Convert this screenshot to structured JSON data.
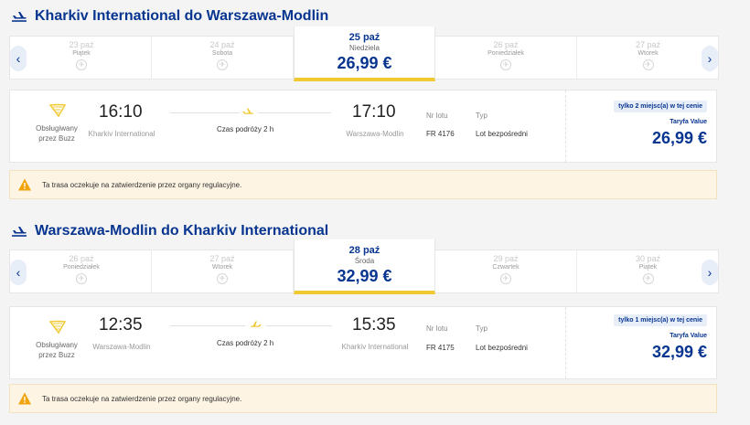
{
  "outbound": {
    "title": "Kharkiv International do Warszawa-Modlin",
    "days": [
      {
        "date": "23 paź",
        "name": "Piątek"
      },
      {
        "date": "24 paź",
        "name": "Sobota"
      },
      {
        "date": "26 paź",
        "name": "Poniedziałek"
      },
      {
        "date": "27 paź",
        "name": "Wtorek"
      }
    ],
    "selected": {
      "date": "25 paź",
      "name": "Niedziela",
      "price": "26,99 €"
    },
    "flight": {
      "operated_by": "Obsługiwany przez Buzz",
      "dep_time": "16:10",
      "dep_city": "Kharkiv International",
      "duration": "Czas podróży 2 h",
      "arr_time": "17:10",
      "arr_city": "Warszawa-Modlin",
      "flight_no_label": "Nr lotu",
      "flight_no": "FR 4176",
      "type_label": "Typ",
      "type": "Lot bezpośredni",
      "seats": "tylko 2 miejsc(a) w tej cenie",
      "fare_name": "Taryfa Value",
      "fare_price": "26,99 €"
    },
    "notice": "Ta trasa oczekuje na zatwierdzenie przez organy regulacyjne."
  },
  "inbound": {
    "title": "Warszawa-Modlin do Kharkiv International",
    "days": [
      {
        "date": "26 paź",
        "name": "Poniedziałek"
      },
      {
        "date": "27 paź",
        "name": "Wtorek"
      },
      {
        "date": "29 paź",
        "name": "Czwartek"
      },
      {
        "date": "30 paź",
        "name": "Piątek"
      }
    ],
    "selected": {
      "date": "28 paź",
      "name": "Środa",
      "price": "32,99 €"
    },
    "flight": {
      "operated_by": "Obsługiwany przez Buzz",
      "dep_time": "12:35",
      "dep_city": "Warszawa-Modlin",
      "duration": "Czas podróży 2 h",
      "arr_time": "15:35",
      "arr_city": "Kharkiv International",
      "flight_no_label": "Nr lotu",
      "flight_no": "FR 4175",
      "type_label": "Typ",
      "type": "Lot bezpośredni",
      "seats": "tylko 1 miejsc(a) w tej cenie",
      "fare_name": "Taryfa Value",
      "fare_price": "32,99 €"
    },
    "notice": "Ta trasa oczekuje na zatwierdzenie przez organy regulacyjne."
  },
  "icons": {
    "plane": "plane-icon",
    "prev": "chevron-left-icon",
    "next": "chevron-right-icon",
    "no_flight": "no-flight-icon",
    "warning": "warning-icon",
    "logo": "operator-logo-icon"
  },
  "colors": {
    "brand": "#073590",
    "accent": "#f1c933",
    "warning": "#f0a30a"
  }
}
